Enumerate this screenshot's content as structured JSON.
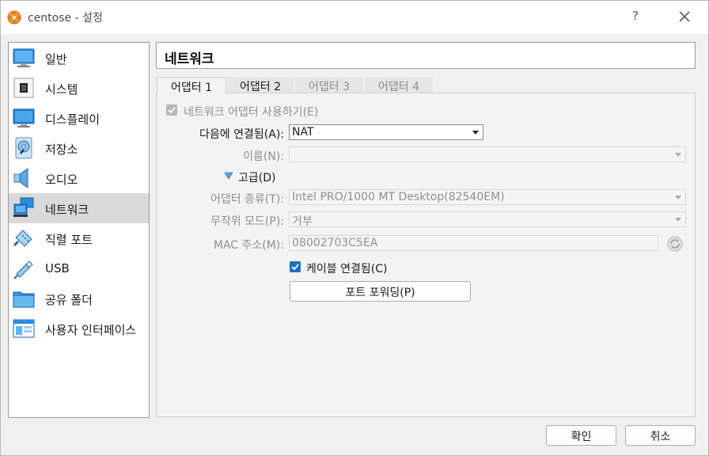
{
  "window": {
    "title": "centose - 설정",
    "help_label": "?"
  },
  "sidebar": {
    "items": [
      {
        "label": "일반",
        "icon": "general-monitor-icon"
      },
      {
        "label": "시스템",
        "icon": "system-chip-icon"
      },
      {
        "label": "디스플레이",
        "icon": "display-monitor-icon"
      },
      {
        "label": "저장소",
        "icon": "storage-disk-icon"
      },
      {
        "label": "오디오",
        "icon": "audio-speaker-icon"
      },
      {
        "label": "네트워크",
        "icon": "network-icon",
        "selected": true
      },
      {
        "label": "직렬 포트",
        "icon": "serial-port-icon"
      },
      {
        "label": "USB",
        "icon": "usb-icon"
      },
      {
        "label": "공유 폴더",
        "icon": "shared-folder-icon"
      },
      {
        "label": "사용자 인터페이스",
        "icon": "user-interface-icon"
      }
    ]
  },
  "page": {
    "title": "네트워크"
  },
  "tabs": [
    {
      "label": "어댑터 1",
      "state": "active"
    },
    {
      "label": "어댑터 2",
      "state": "normal"
    },
    {
      "label": "어댑터 3",
      "state": "disabled"
    },
    {
      "label": "어댑터 4",
      "state": "disabled"
    }
  ],
  "form": {
    "enable_adapter_label": "네트워크 어댑터 사용하기(E)",
    "attached_to_label": "다음에 연결됨(A):",
    "attached_to_value": "NAT",
    "name_label": "이름(N):",
    "name_value": "",
    "advanced_label": "고급(D)",
    "adapter_type_label": "어댑터 종류(T):",
    "adapter_type_value": "Intel PRO/1000 MT Desktop(82540EM)",
    "promisc_label": "무작위 모드(P):",
    "promisc_value": "거부",
    "mac_label": "MAC 주소(M):",
    "mac_value": "08002703C5EA",
    "cable_label": "케이블 연결됨(C)",
    "port_forwarding_label": "포트 포워딩(P)"
  },
  "footer": {
    "ok_label": "확인",
    "cancel_label": "취소"
  },
  "colors": {
    "accent": "#1d6fc4",
    "selected_bg": "#d9d9d9"
  }
}
